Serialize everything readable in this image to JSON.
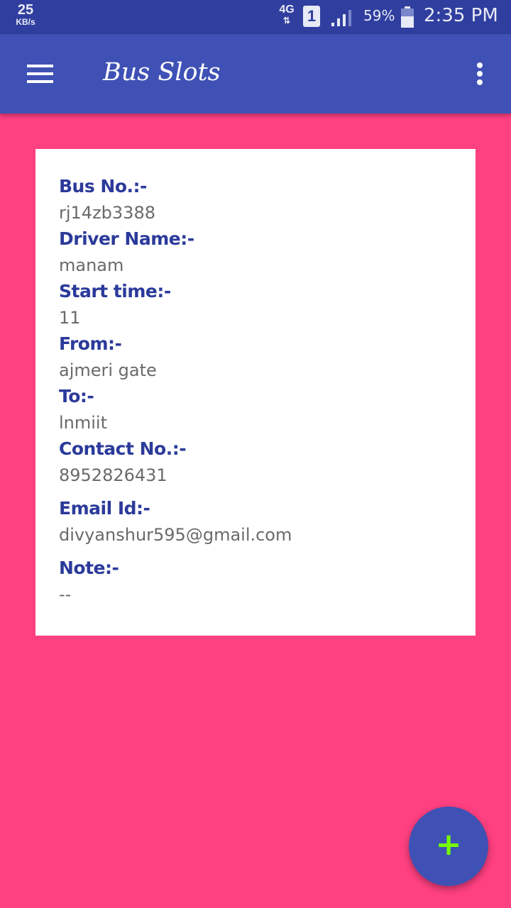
{
  "status_bar": {
    "net_speed_value": "25",
    "net_speed_unit": "KB/s",
    "network_type": "4G",
    "network_arrows": "⇅",
    "sim_slot": "1",
    "battery_percent": "59%",
    "battery_level": 0.59,
    "time": "2:35 PM"
  },
  "app_bar": {
    "title": "Bus Slots",
    "menu_icon": "hamburger-menu-icon",
    "overflow_icon": "more-vert-icon"
  },
  "details": {
    "bus_no_label": "Bus No.:-",
    "bus_no_value": "rj14zb3388",
    "driver_label": "Driver Name:-",
    "driver_value": "manam",
    "start_time_label": "Start time:-",
    "start_time_value": "11",
    "from_label": "From:-",
    "from_value": "ajmeri gate",
    "to_label": "To:-",
    "to_value": "lnmiit",
    "contact_label": "Contact No.:-",
    "contact_value": "8952826431",
    "email_label": "Email Id:-",
    "email_value": "divyanshur595@gmail.com",
    "note_label": "Note:-",
    "note_value": "--"
  },
  "fab": {
    "label": "+",
    "icon": "add-icon"
  },
  "colors": {
    "status_bar": "#303f9f",
    "app_bar": "#3f51b5",
    "background": "#ff4081",
    "card": "#ffffff",
    "label": "#2b3a9a",
    "value": "#6a6a6a",
    "fab_icon": "#76ff03"
  }
}
